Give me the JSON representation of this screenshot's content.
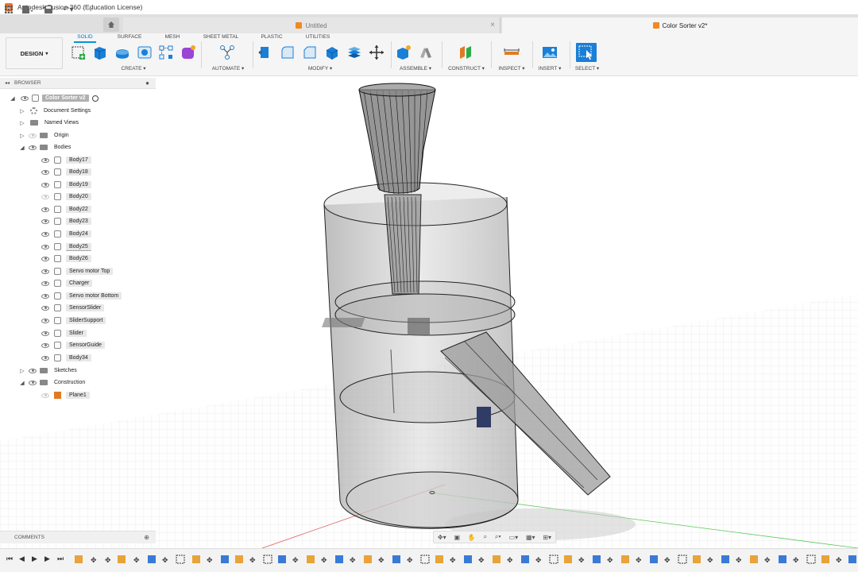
{
  "window": {
    "title": "Autodesk Fusion 360 (Education License)"
  },
  "tabs": {
    "inactive": {
      "label": "Untitled"
    },
    "active": {
      "label": "Color Sorter v2*"
    }
  },
  "ribbon": {
    "workspace": "DESIGN",
    "tabs": [
      "SOLID",
      "SURFACE",
      "MESH",
      "SHEET METAL",
      "PLASTIC",
      "UTILITIES"
    ],
    "active_tab": "SOLID",
    "groups": [
      "CREATE",
      "AUTOMATE",
      "MODIFY",
      "ASSEMBLE",
      "CONSTRUCT",
      "INSPECT",
      "INSERT",
      "SELECT"
    ]
  },
  "browser": {
    "header": "BROWSER",
    "root": "Color Sorter v2",
    "items": [
      {
        "label": "Document Settings"
      },
      {
        "label": "Named Views"
      },
      {
        "label": "Origin"
      },
      {
        "label": "Bodies"
      },
      {
        "label": "Body17"
      },
      {
        "label": "Body18"
      },
      {
        "label": "Body19"
      },
      {
        "label": "Body20"
      },
      {
        "label": "Body22"
      },
      {
        "label": "Body23"
      },
      {
        "label": "Body24"
      },
      {
        "label": "Body25"
      },
      {
        "label": "Body26"
      },
      {
        "label": "Servo motor Top"
      },
      {
        "label": "Charger"
      },
      {
        "label": "Servo motor Bottom"
      },
      {
        "label": "SensorSlider"
      },
      {
        "label": "SliderSupport"
      },
      {
        "label": "Slider"
      },
      {
        "label": "SensorGuide"
      },
      {
        "label": "Body34"
      },
      {
        "label": "Sketches"
      },
      {
        "label": "Construction"
      },
      {
        "label": "Plane1"
      }
    ]
  },
  "comments": {
    "label": "COMMENTS"
  },
  "colors": {
    "accent": "#0696d7",
    "brand": "#e8722e",
    "tab_active_text": "#0070c0"
  }
}
